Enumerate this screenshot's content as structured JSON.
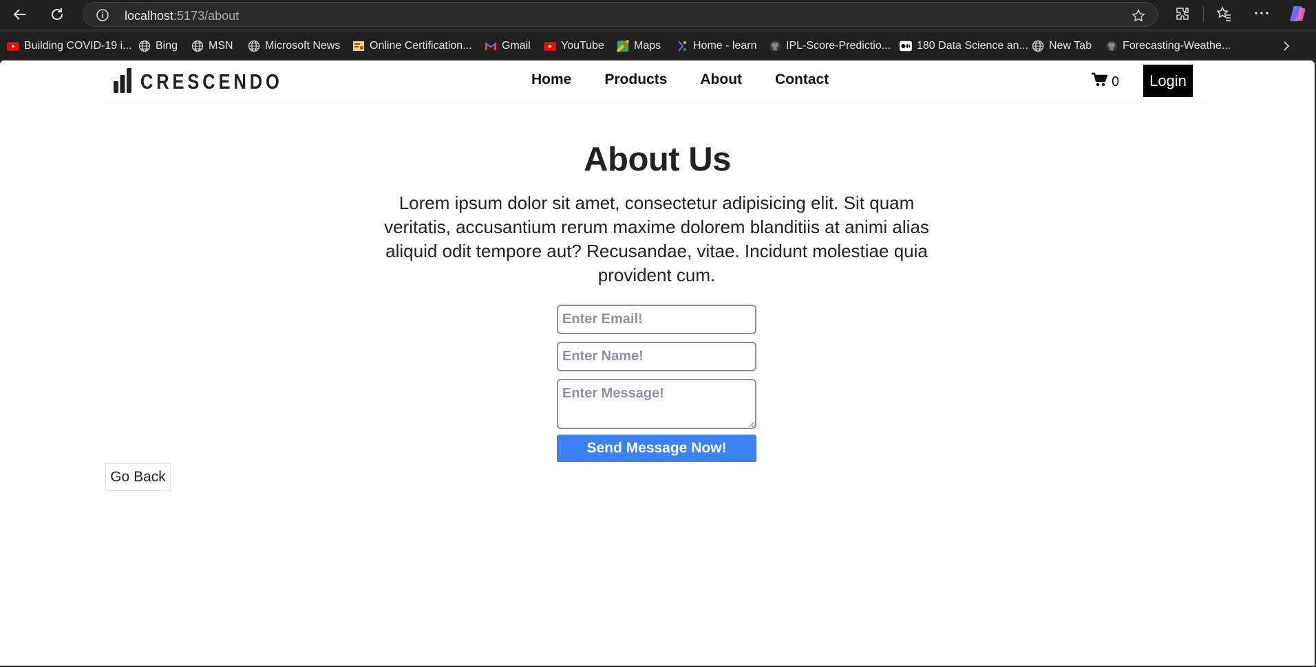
{
  "browser": {
    "url_host": "localhost",
    "url_path": ":5173/about",
    "bookmarks": [
      {
        "label": "Building COVID-19 i...",
        "icon": "youtube-icon"
      },
      {
        "label": "Bing",
        "icon": "globe-icon"
      },
      {
        "label": "MSN",
        "icon": "globe-icon"
      },
      {
        "label": "Microsoft News",
        "icon": "globe-icon"
      },
      {
        "label": "Online Certification...",
        "icon": "certificate-icon"
      },
      {
        "label": "Gmail",
        "icon": "gmail-icon"
      },
      {
        "label": "YouTube",
        "icon": "youtube-icon"
      },
      {
        "label": "Maps",
        "icon": "maps-icon"
      },
      {
        "label": "Home - learn",
        "icon": "learn-icon"
      },
      {
        "label": "IPL-Score-Predictio...",
        "icon": "github-icon"
      },
      {
        "label": "180 Data Science an...",
        "icon": "medium-icon"
      },
      {
        "label": "New Tab",
        "icon": "globe-icon"
      },
      {
        "label": "Forecasting-Weathe...",
        "icon": "github-icon"
      }
    ]
  },
  "site": {
    "logo": "CRESCENDO",
    "menu": [
      "Home",
      "Products",
      "About",
      "Contact"
    ],
    "cart_count": "0",
    "login_label": "Login"
  },
  "about": {
    "title": "About Us",
    "text": "Lorem ipsum dolor sit amet, consectetur adipisicing elit. Sit quam veritatis, accusantium rerum maxime dolorem blanditiis at animi alias aliquid odit tempore aut? Recusandae, vitae. Incidunt molestiae quia provident cum."
  },
  "form": {
    "email_placeholder": "Enter Email!",
    "name_placeholder": "Enter Name!",
    "message_placeholder": "Enter Message!",
    "submit_label": "Send Message Now!"
  },
  "back_label": "Go Back",
  "colors": {
    "chrome_bg": "#202020",
    "accent_blue": "#3b82f6",
    "login_bg": "#000000"
  }
}
